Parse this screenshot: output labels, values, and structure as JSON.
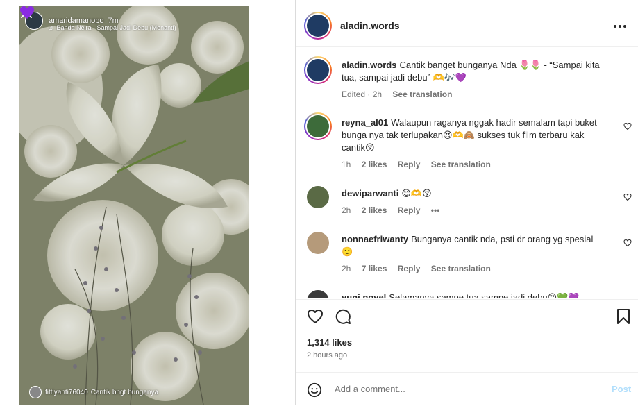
{
  "story": {
    "username": "amaridamanopo",
    "time": "7m",
    "music": "Banda Neira · Sampai Jadi Debu (Menanti)",
    "reply_user": "fittiyanti76040",
    "reply_text": "Cantik bngt bunganya",
    "close_icon": "close-icon",
    "heart_icon": "purple-heart-icon"
  },
  "post": {
    "author": "aladin.words",
    "more_icon": "more-options-icon"
  },
  "comments": [
    {
      "user": "aladin.words",
      "text": "Cantik banget bunganya Nda 🌷🌷 - “Sampai kita tua, sampai jadi debu” 🫶🎶💜",
      "time": "Edited · 2h",
      "likes": "",
      "reply": "",
      "translation": "See translation",
      "color": "#1f3b63"
    },
    {
      "user": "reyna_al01",
      "text": "Walaupun raganya nggak hadir semalam tapi buket bunga nya tak terlupakan😍🫶🙈 sukses tuk film terbaru kak cantik😚",
      "time": "1h",
      "likes": "2 likes",
      "reply": "Reply",
      "translation": "See translation",
      "color": "#3d6b3a"
    },
    {
      "user": "dewiparwanti",
      "text": "😊🫶😚",
      "time": "2h",
      "likes": "2 likes",
      "reply": "Reply",
      "translation": "•••",
      "color": "#5a6a45"
    },
    {
      "user": "nonnaefriwanty",
      "text": "Bunganya cantik nda, psti dr orang yg spesial 🙂",
      "time": "2h",
      "likes": "7 likes",
      "reply": "Reply",
      "translation": "See translation",
      "color": "#b59a7a"
    },
    {
      "user": "yuni.novel",
      "text": "Selamanya sampe tua sampe jadi debu😍💚💜",
      "time": "",
      "likes": "",
      "reply": "",
      "translation": "",
      "color": "#3a3a3a"
    }
  ],
  "actions": {
    "likes": "1,314 likes",
    "ago": "2 hours ago",
    "comment_placeholder": "Add a comment...",
    "post_label": "Post"
  },
  "colors": {
    "accent": "#0095f6",
    "post_disabled": "#b2dffc",
    "muted": "#737373"
  }
}
